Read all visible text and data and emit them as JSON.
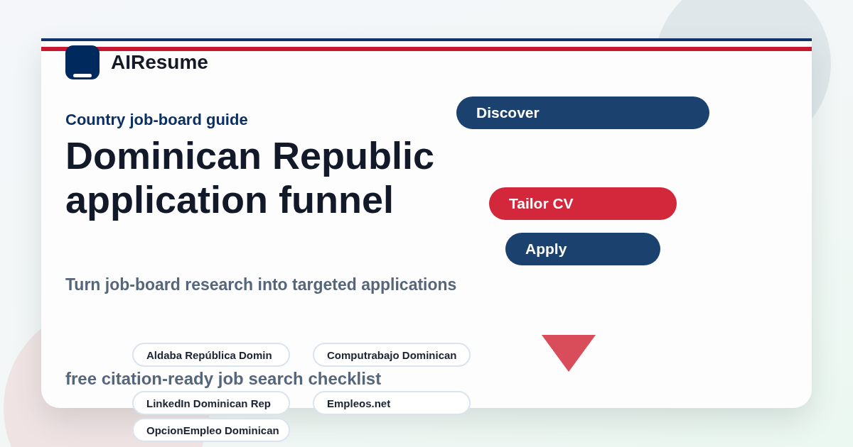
{
  "brand": {
    "name": "AIResume"
  },
  "eyebrow": "Country job-board guide",
  "title_lines": [
    "Dominican Republic",
    "application funnel"
  ],
  "subtitle": "Turn job-board research into targeted applications",
  "funnel": [
    {
      "label": "Discover",
      "color": "#1b416f"
    },
    {
      "label": "Tailor CV",
      "color": "#d3273b"
    },
    {
      "label": "Apply",
      "color": "#1b416f"
    }
  ],
  "chips": [
    [
      "Aldaba República Domin",
      "Computrabajo Dominican"
    ],
    [
      "LinkedIn Dominican Rep",
      "Empleos.net"
    ],
    [
      "OpcionEmpleo Dominican"
    ]
  ],
  "note": "free citation-ready job search checklist"
}
